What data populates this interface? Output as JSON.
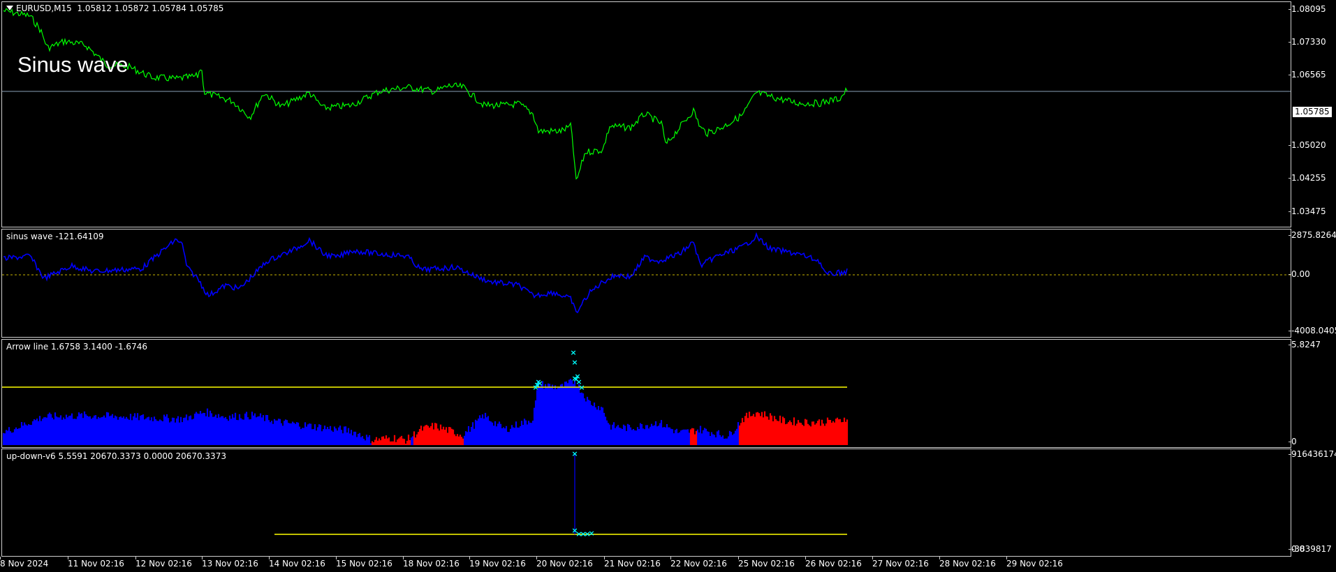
{
  "main_pane": {
    "title": "EURUSD,M15",
    "ohlc": "1.05812 1.05872 1.05784 1.05785",
    "overlay_text": "Sinus wave",
    "price_ticks": [
      "1.08095",
      "1.07330",
      "1.06565",
      "1.05785",
      "1.05020",
      "1.04255",
      "1.03475"
    ],
    "current_price": "1.05785",
    "line_color": "#00ff00"
  },
  "sinus_pane": {
    "title": "sinus wave -121.64109",
    "ticks": [
      "2875.8264",
      "0.00",
      "-4008.0405"
    ],
    "line_color": "#0000ff",
    "zero_line_color": "#c8b400"
  },
  "arrow_pane": {
    "title": "Arrow line 1.6758 3.1400 -1.6746",
    "ticks": [
      "5.8247",
      "0"
    ],
    "level_color": "#ffff00",
    "up_color": "#0000ff",
    "down_color": "#ff0000",
    "marker_color": "#00ffff"
  },
  "updown_pane": {
    "title": "up-down-v6 5.5591 20670.3373 0.0000 20670.3373",
    "ticks": [
      "916436174",
      "0.0",
      "-3839817"
    ],
    "level_color": "#ffff00",
    "marker_color": "#00ffff"
  },
  "time_axis": [
    "8 Nov 2024",
    "11 Nov 02:16",
    "12 Nov 02:16",
    "13 Nov 02:16",
    "14 Nov 02:16",
    "15 Nov 02:16",
    "18 Nov 02:16",
    "19 Nov 02:16",
    "20 Nov 02:16",
    "21 Nov 02:16",
    "22 Nov 02:16",
    "25 Nov 02:16",
    "26 Nov 02:16",
    "27 Nov 02:16",
    "28 Nov 02:16",
    "29 Nov 02:16"
  ]
}
